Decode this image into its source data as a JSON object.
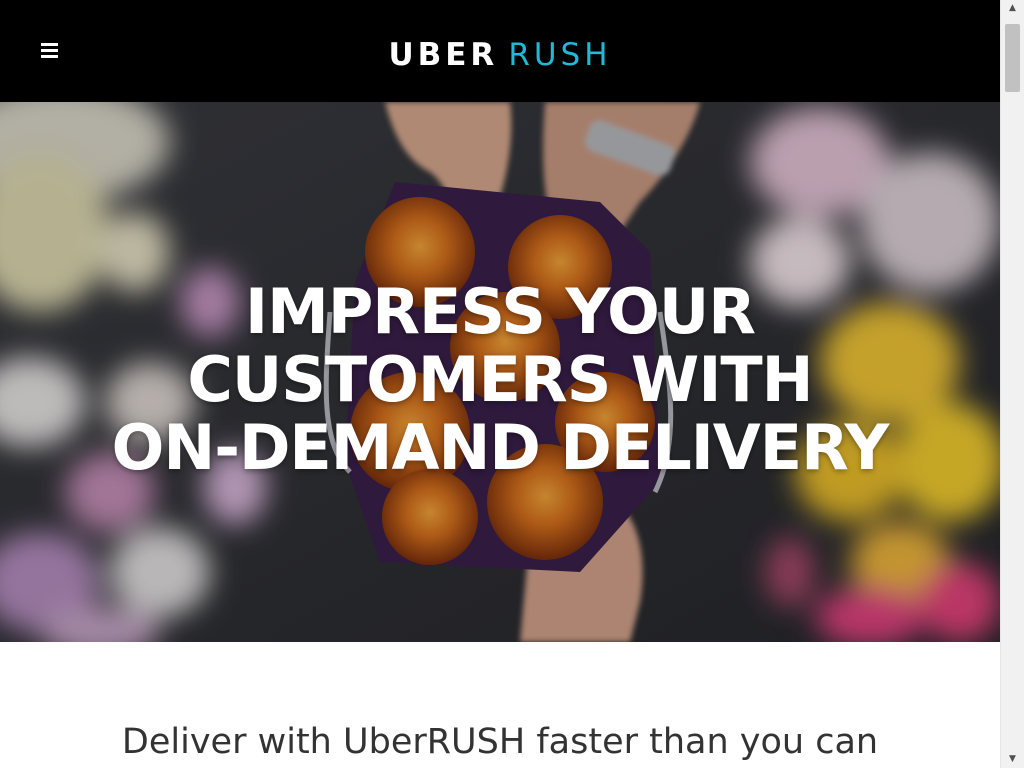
{
  "header": {
    "menu_icon": "hamburger-menu-icon",
    "brand_primary": "UBER",
    "brand_secondary": "RUSH",
    "colors": {
      "background": "#000000",
      "brand_primary": "#ffffff",
      "brand_secondary": "#1fbad6"
    }
  },
  "hero": {
    "title_lines": [
      "IMPRESS YOUR",
      "CUSTOMERS WITH",
      "ON-DEMAND DELIVERY"
    ],
    "image": "florist-handing-bouquet-of-orange-roses-photo"
  },
  "intro": {
    "text": "Deliver with UberRUSH faster than you can"
  },
  "scrollbar": {
    "up_icon": "scroll-up-arrow-icon",
    "down_icon": "scroll-down-arrow-icon"
  }
}
